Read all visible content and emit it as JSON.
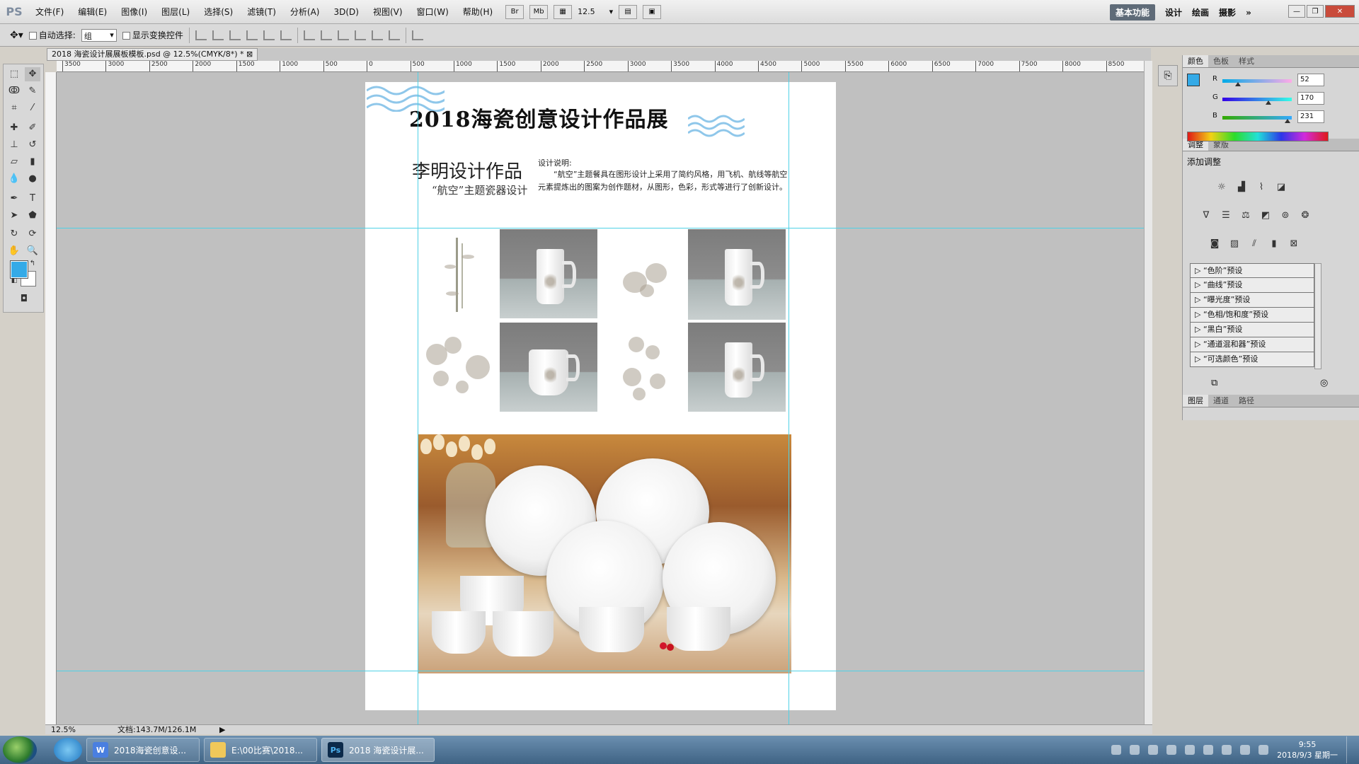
{
  "app": {
    "logo": "PS",
    "menus": [
      "文件(F)",
      "编辑(E)",
      "图像(I)",
      "图层(L)",
      "选择(S)",
      "滤镜(T)",
      "分析(A)",
      "3D(D)",
      "视图(V)",
      "窗口(W)",
      "帮助(H)"
    ],
    "bar_buttons": [
      "Br",
      "Mb"
    ],
    "zoom_select": "12.5",
    "workspace_active": "基本功能",
    "workspaces": [
      "设计",
      "绘画",
      "摄影"
    ],
    "more": "»"
  },
  "options": {
    "auto_select_label": "自动选择:",
    "auto_select_value": "组",
    "show_transform_label": "显示变换控件"
  },
  "document_tab": "2018 海瓷设计展展板模板.psd @ 12.5%(CMYK/8*) *",
  "ruler_ticks": [
    "3500",
    "3000",
    "2500",
    "2000",
    "1500",
    "1000",
    "500",
    "0",
    "500",
    "1000",
    "1500",
    "2000",
    "2500",
    "3000",
    "3500",
    "4000",
    "4500",
    "5000",
    "5500",
    "6000",
    "6500",
    "7000",
    "7500",
    "8000",
    "8500"
  ],
  "poster": {
    "title": "2018海瓷创意设计作品展",
    "author": "李明设计作品",
    "subtitle": "“航空”主题瓷器设计",
    "desc_title": "设计说明:",
    "desc": "“航空”主题餐具在图形设计上采用了简约风格，用飞机、航线等航空元素提炼出的图案为创作题材，从图形，色彩，形式等进行了创新设计。"
  },
  "colors": {
    "foreground": "#34aae7",
    "guide": "#4fd1e6"
  },
  "color_panel": {
    "tabs": [
      "颜色",
      "色板",
      "样式"
    ],
    "r_label": "R",
    "r": "52",
    "g_label": "G",
    "g": "170",
    "b_label": "B",
    "b": "231"
  },
  "adjust_panel": {
    "tabs": [
      "调整",
      "蒙版"
    ],
    "heading": "添加调整",
    "presets": [
      "“色阶”预设",
      "“曲线”预设",
      "“曝光度”预设",
      "“色相/饱和度”预设",
      "“黑白”预设",
      "“通道混和器”预设",
      "“可选颜色”预设"
    ]
  },
  "layers_panel": {
    "tabs": [
      "图层",
      "通道",
      "路径"
    ]
  },
  "status": {
    "zoom": "12.5%",
    "doc_size": "文档:143.7M/126.1M"
  },
  "taskbar": {
    "tasks": [
      {
        "label": "2018海瓷创意设...",
        "icon": "W"
      },
      {
        "label": "E:\\00比赛\\2018...",
        "icon": ""
      },
      {
        "label": "2018 海瓷设计展...",
        "icon": "Ps"
      }
    ],
    "time": "9:55",
    "date": "2018/9/3 星期一"
  }
}
